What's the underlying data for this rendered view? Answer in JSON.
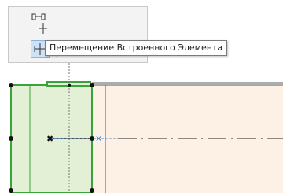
{
  "tooltip": {
    "text": "Перемещение Встроенного Элемента"
  },
  "pet_palette": {
    "icons": [
      "offset-move-icon",
      "move-embedded-element-icon",
      "stretch-icon",
      "rotate-icon",
      "mirror-icon",
      "elevate-icon"
    ],
    "selected_icon": "move-embedded-element-icon"
  },
  "colors": {
    "selected_element_fill": "#e4f0d6",
    "selected_element_outline": "#39a33a",
    "wall_fill": "#fdf0e4",
    "wall_outline": "#5a5a5a",
    "palette_background": "#f3f3f3",
    "selected_icon_background": "#cfe2f5",
    "snap_line": "#4a90d9"
  }
}
